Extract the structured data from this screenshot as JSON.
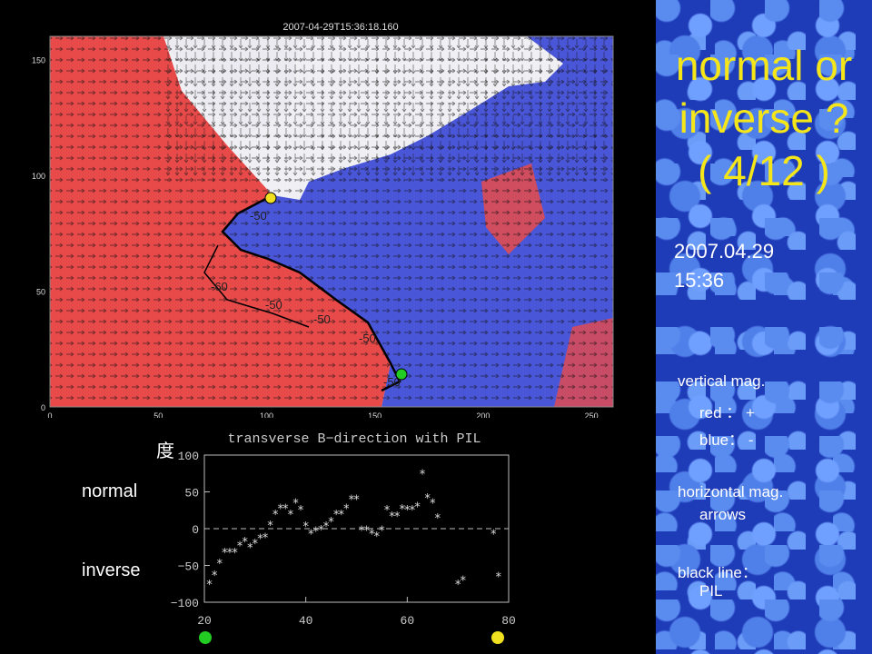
{
  "magnetogram": {
    "timestamp": "2007-04-29T15:36:18.160",
    "y_ticks": [
      "150",
      "100",
      "50",
      "0"
    ],
    "x_ticks": [
      "0",
      "50",
      "100",
      "150",
      "200",
      "250"
    ],
    "contour_labels": [
      "-60",
      "-50",
      "-50",
      "-50",
      "-50",
      "-50"
    ],
    "colors": {
      "positive": "#e84a4a",
      "negative": "#4a56d8",
      "pil": "#000000"
    }
  },
  "scatter": {
    "degree_label": "度",
    "normal_label": "normal",
    "inverse_label": "inverse"
  },
  "chart_data": {
    "type": "scatter",
    "title": "transverse B−direction with PIL",
    "xlabel": "",
    "ylabel": "",
    "xlim": [
      20,
      80
    ],
    "ylim": [
      -100,
      100
    ],
    "x_ticks": [
      "20",
      "40",
      "60",
      "80"
    ],
    "y_ticks": [
      "100",
      "50",
      "0",
      "−50",
      "−100"
    ],
    "reference_line": 0,
    "series": [
      {
        "x": [
          21,
          22,
          23,
          24,
          25,
          26,
          27,
          28,
          29,
          30,
          31,
          32,
          33,
          34,
          35,
          36,
          37,
          38,
          39,
          40,
          41,
          42,
          43,
          44,
          45,
          46,
          47,
          48,
          49,
          50,
          51,
          52,
          53,
          54,
          55,
          56,
          57,
          58,
          59,
          60,
          61,
          62,
          63,
          64,
          65,
          66,
          70,
          71,
          77,
          78
        ],
        "y": [
          -75,
          -63,
          -47,
          -32,
          -32,
          -32,
          -23,
          -17,
          -25,
          -20,
          -13,
          -12,
          5,
          20,
          28,
          28,
          20,
          35,
          26,
          4,
          -7,
          -3,
          -1,
          4,
          10,
          20,
          20,
          28,
          40,
          40,
          -2,
          -2,
          -7,
          -10,
          -2,
          26,
          17,
          17,
          27,
          26,
          26,
          30,
          75,
          42,
          35,
          15,
          -75,
          -70,
          -7,
          -65
        ]
      }
    ]
  },
  "dots": {
    "yellow": "#f0e020",
    "green": "#22cc22"
  },
  "side": {
    "title_line1": "normal or",
    "title_line2": "inverse ?",
    "title_line3": "( 4/12 )",
    "date": "2007.04.29",
    "time": "15:36",
    "legend_vertical": "vertical mag.",
    "legend_red": "red ： +",
    "legend_blue": "blue： -",
    "legend_horizontal": "horizontal mag.",
    "legend_arrows": "arrows",
    "legend_black": "black line：",
    "legend_pil": "PIL"
  }
}
